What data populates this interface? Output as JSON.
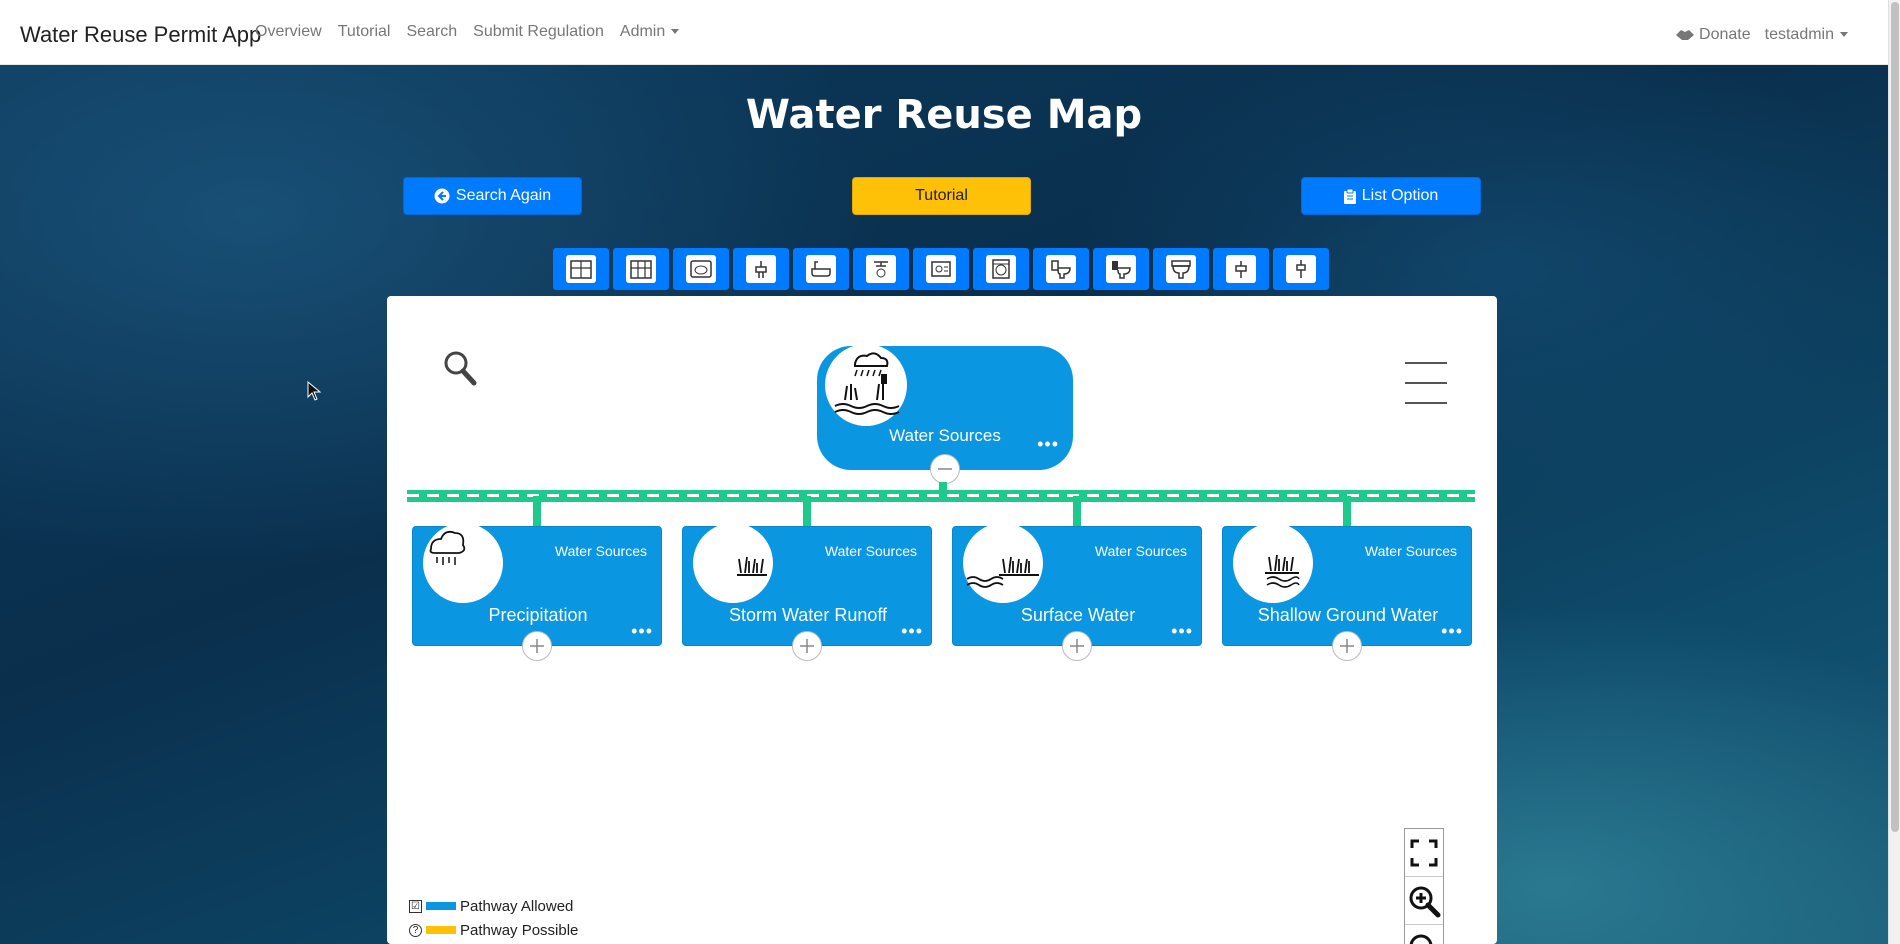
{
  "navbar": {
    "brand": "Water Reuse Permit App",
    "links": [
      "Overview",
      "Tutorial",
      "Search",
      "Submit Regulation"
    ],
    "admin_label": "Admin",
    "donate_label": "Donate",
    "user_label": "testadmin"
  },
  "page": {
    "title": "Water Reuse Map"
  },
  "actions": {
    "search_again": "Search Again",
    "tutorial": "Tutorial",
    "list_option": "List Option"
  },
  "toolbar_icons": [
    "building-icon",
    "building-icon",
    "washer-icon",
    "sink-icon",
    "bathtub-icon",
    "shower-icon",
    "dishwasher-icon",
    "laundry-icon",
    "toilet-icon",
    "toilet-icon",
    "toilet-icon",
    "faucet-icon",
    "faucet-icon"
  ],
  "map": {
    "root": {
      "label": "Water Sources",
      "icon": "water-sources-icon"
    },
    "children": [
      {
        "category": "Water Sources",
        "label": "Precipitation",
        "icon": "rain-cloud-icon"
      },
      {
        "category": "Water Sources",
        "label": "Storm Water Runoff",
        "icon": "grass-icon"
      },
      {
        "category": "Water Sources",
        "label": "Surface Water",
        "icon": "grass-water-icon"
      },
      {
        "category": "Water Sources",
        "label": "Shallow Ground Water",
        "icon": "ground-water-icon"
      }
    ],
    "colors": {
      "node": "#0a96e0",
      "connector": "#1ec98c"
    }
  },
  "legend": [
    {
      "symbol": "☑",
      "label": "Pathway Allowed",
      "color": "#0a96e0"
    },
    {
      "symbol": "?",
      "label": "Pathway Possible",
      "color": "#ffc107"
    }
  ]
}
